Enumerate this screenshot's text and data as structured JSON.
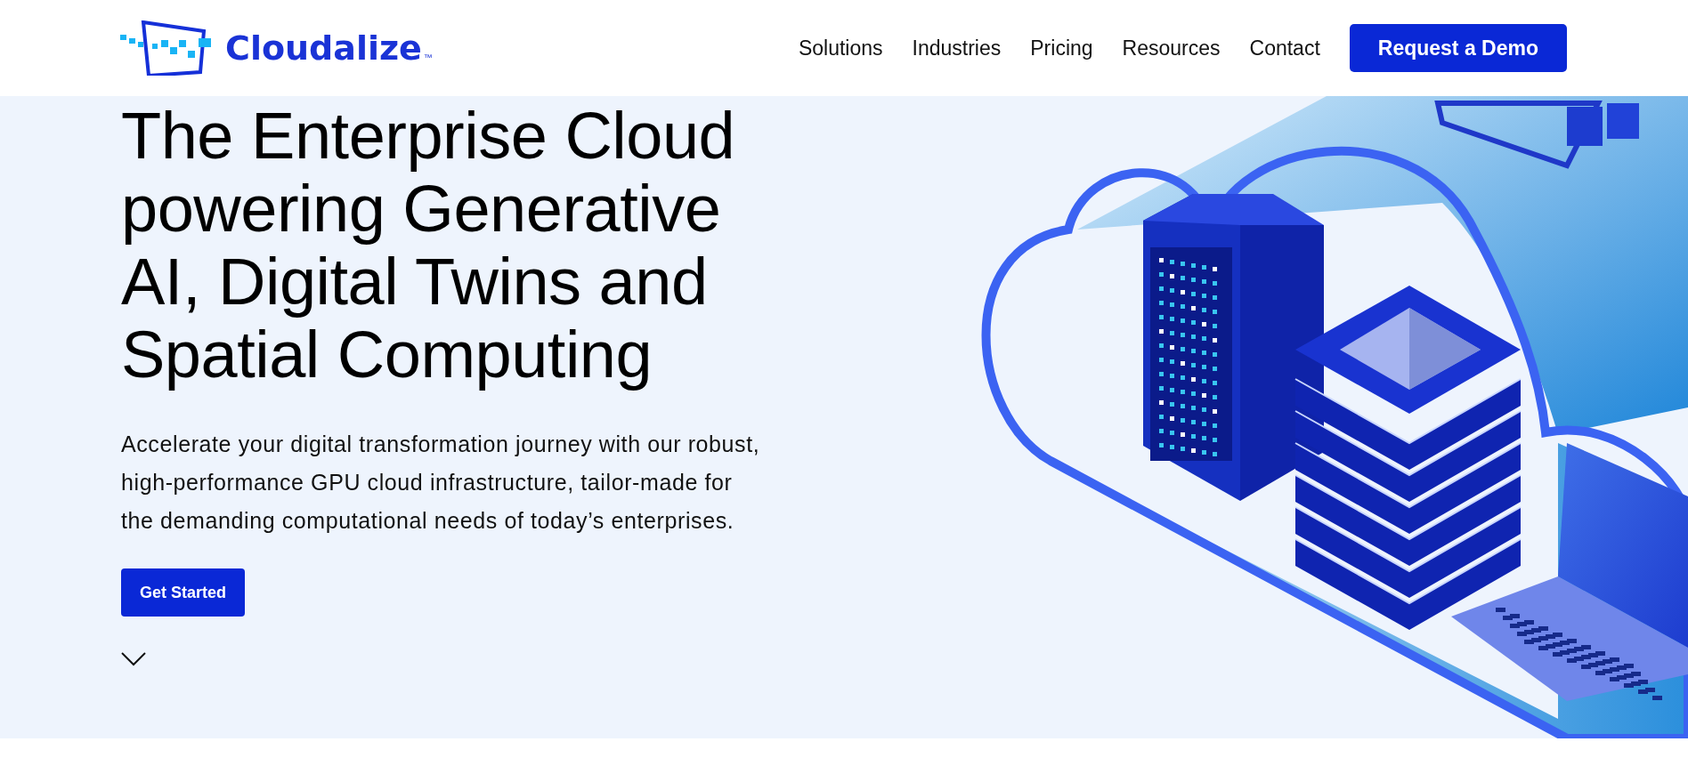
{
  "header": {
    "logo": {
      "name": "Cloudalize",
      "trademark": "™"
    },
    "nav": [
      {
        "label": "Solutions"
      },
      {
        "label": "Industries"
      },
      {
        "label": "Pricing"
      },
      {
        "label": "Resources"
      },
      {
        "label": "Contact"
      }
    ],
    "cta": "Request a Demo"
  },
  "hero": {
    "heading_lines": [
      "The Enterprise Cloud",
      "powering Generative",
      "AI, Digital Twins and",
      "Spatial Computing"
    ],
    "description_lines": [
      "Accelerate your digital transformation journey with our robust,",
      "high-performance GPU cloud infrastructure, tailor-made for",
      "the demanding computational needs of today’s enterprises."
    ],
    "button": "Get Started"
  }
}
